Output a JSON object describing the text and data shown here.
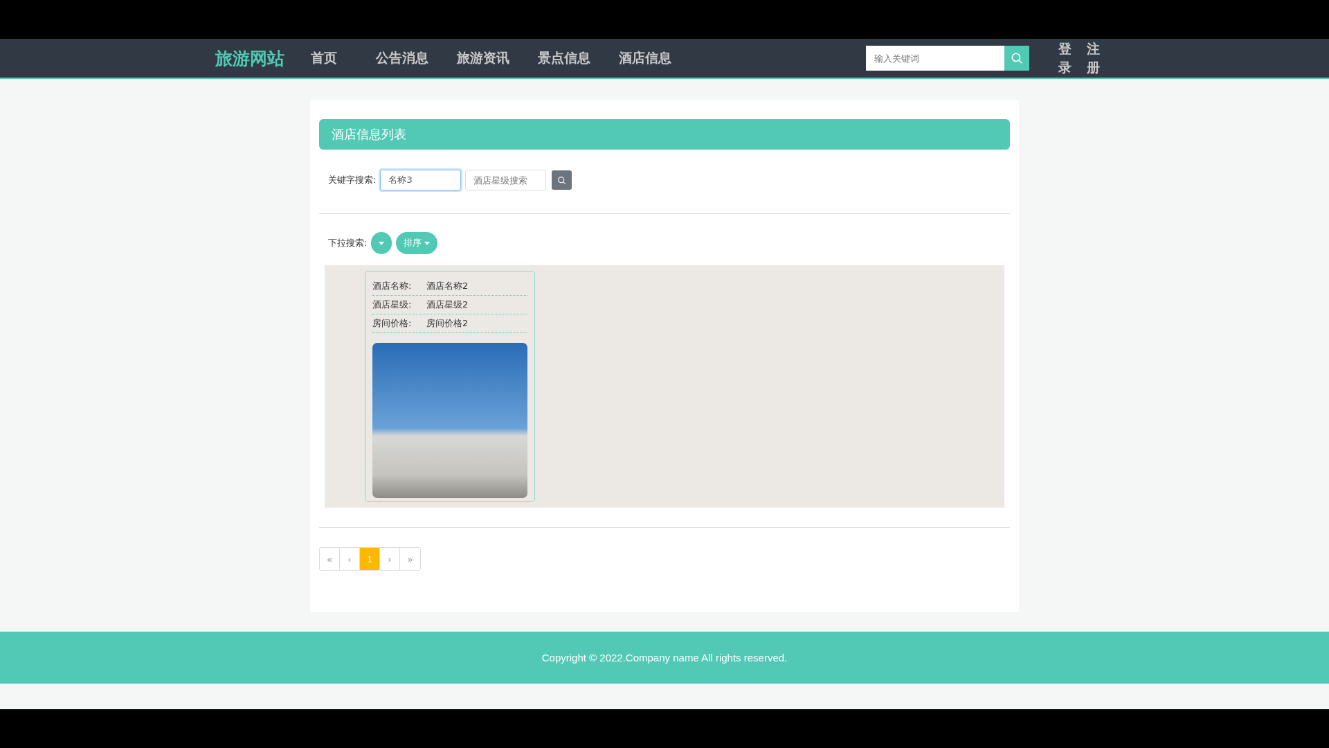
{
  "nav": {
    "logo": "旅游网站",
    "links": [
      {
        "label": "首页",
        "selected": false
      },
      {
        "label": "公告消息",
        "selected": false
      },
      {
        "label": "旅游资讯",
        "selected": false
      },
      {
        "label": "景点信息",
        "selected": false
      },
      {
        "label": "酒店信息",
        "selected": false
      }
    ],
    "search": {
      "placeholder": "输入关键词"
    },
    "auth": [
      "登录",
      "注册"
    ]
  },
  "panel": {
    "title": "酒店信息列表",
    "keyword_label": "关键字搜索:",
    "name_field": {
      "value": "名称3"
    },
    "star_field": {
      "placeholder": "酒店星级搜索"
    },
    "dropdown_label": "下拉搜索:",
    "sort_button": "排序"
  },
  "hotels": [
    {
      "fields": [
        {
          "label": "酒店名称:",
          "value": "酒店名称2"
        },
        {
          "label": "酒店星级:",
          "value": "酒店星级2"
        },
        {
          "label": "房间价格:",
          "value": "房间价格2"
        }
      ]
    }
  ],
  "pager": [
    {
      "label": "«",
      "selected": false
    },
    {
      "label": "‹",
      "selected": false
    },
    {
      "label": "1",
      "selected": true
    },
    {
      "label": "›",
      "selected": false
    },
    {
      "label": "»",
      "selected": false
    }
  ],
  "footer": "Copyright © 2022.Company name All rights reserved."
}
